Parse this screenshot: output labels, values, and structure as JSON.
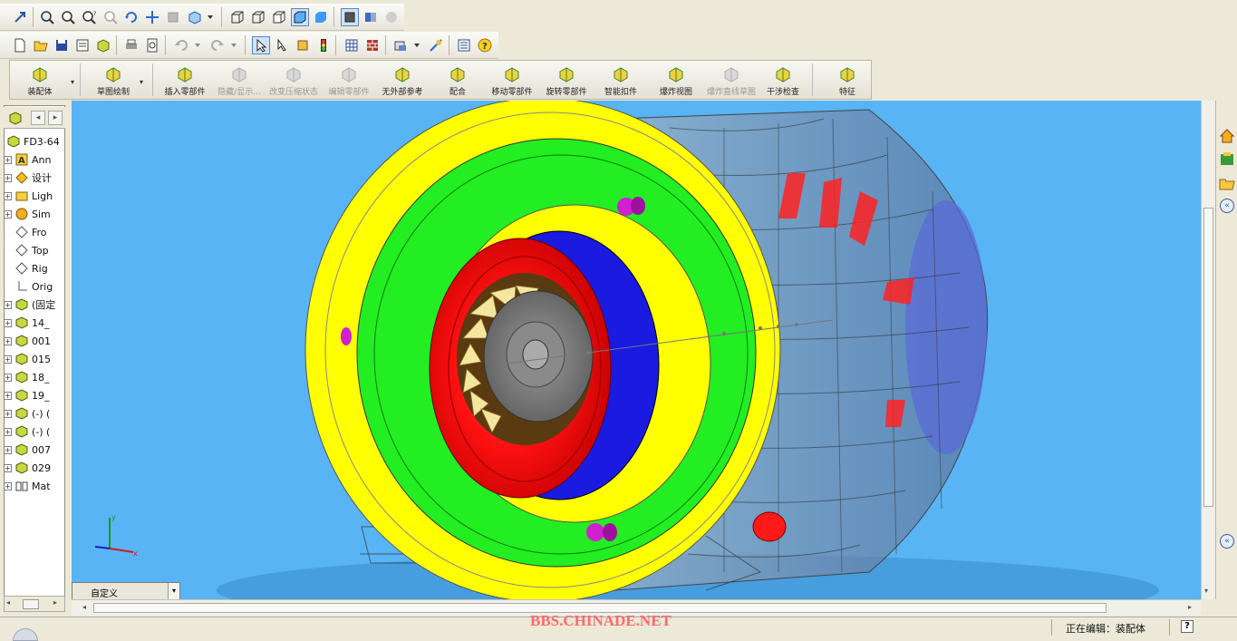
{
  "toolbar_commands": [
    {
      "label": "装配体",
      "icon": "assembly-icon",
      "enabled": true
    },
    {
      "label": "草图绘制",
      "icon": "sketch-icon",
      "enabled": true
    },
    {
      "label": "插入零部件",
      "icon": "insert-component-icon",
      "enabled": true
    },
    {
      "label": "隐藏/显示...",
      "icon": "hide-show-icon",
      "enabled": false
    },
    {
      "label": "改变压缩状态",
      "icon": "suppress-state-icon",
      "enabled": false
    },
    {
      "label": "编辑零部件",
      "icon": "edit-component-icon",
      "enabled": false
    },
    {
      "label": "无外部参考",
      "icon": "no-external-references-icon",
      "enabled": true
    },
    {
      "label": "配合",
      "icon": "mate-icon",
      "enabled": true
    },
    {
      "label": "移动零部件",
      "icon": "move-component-icon",
      "enabled": true
    },
    {
      "label": "旋转零部件",
      "icon": "rotate-component-icon",
      "enabled": true
    },
    {
      "label": "智能扣件",
      "icon": "smart-fasteners-icon",
      "enabled": true
    },
    {
      "label": "爆炸视图",
      "icon": "exploded-view-icon",
      "enabled": true
    },
    {
      "label": "爆炸直线草图",
      "icon": "explode-line-sketch-icon",
      "enabled": false
    },
    {
      "label": "干涉检查",
      "icon": "interference-check-icon",
      "enabled": true
    },
    {
      "label": "特征",
      "icon": "features-icon",
      "enabled": true
    }
  ],
  "feature_tree": {
    "root": "FD3-64",
    "items": [
      {
        "label": "Ann",
        "icon": "annotations-icon",
        "expandable": true
      },
      {
        "label": "设计",
        "icon": "design-binder-icon",
        "expandable": true
      },
      {
        "label": "Ligh",
        "icon": "lights-icon",
        "expandable": true
      },
      {
        "label": "Sim",
        "icon": "simulation-icon",
        "expandable": true
      },
      {
        "label": "Fro",
        "icon": "plane-icon",
        "expandable": false
      },
      {
        "label": "Top",
        "icon": "plane-icon",
        "expandable": false
      },
      {
        "label": "Rig",
        "icon": "plane-icon",
        "expandable": false
      },
      {
        "label": "Orig",
        "icon": "origin-icon",
        "expandable": false
      },
      {
        "label": "(固定",
        "icon": "component-icon",
        "expandable": true
      },
      {
        "label": "14_",
        "icon": "component-icon",
        "expandable": true
      },
      {
        "label": "001",
        "icon": "component-icon",
        "expandable": true
      },
      {
        "label": "015",
        "icon": "component-icon",
        "expandable": true
      },
      {
        "label": "18_",
        "icon": "component-icon",
        "expandable": true
      },
      {
        "label": "19_",
        "icon": "component-icon",
        "expandable": true
      },
      {
        "label": "(-) (",
        "icon": "component-icon",
        "expandable": true
      },
      {
        "label": "(-) (",
        "icon": "component-icon",
        "expandable": true
      },
      {
        "label": "007",
        "icon": "component-icon",
        "expandable": true
      },
      {
        "label": "029",
        "icon": "component-icon",
        "expandable": true
      },
      {
        "label": "Mat",
        "icon": "mates-icon",
        "expandable": true
      }
    ]
  },
  "view": {
    "orientation_select": "自定义",
    "background_color": "#58b4f4"
  },
  "statusbar": {
    "status_text": "正在编辑：装配体",
    "watermark": "BBS.CHINADE.NET",
    "help_icon": "help-icon"
  },
  "colors": {
    "ring_yellow": "#ffff00",
    "ring_green": "#22ee22",
    "inlet_red": "#ff1111",
    "blue_ring": "#1a1ae0",
    "accent_magenta": "#d020d0"
  }
}
